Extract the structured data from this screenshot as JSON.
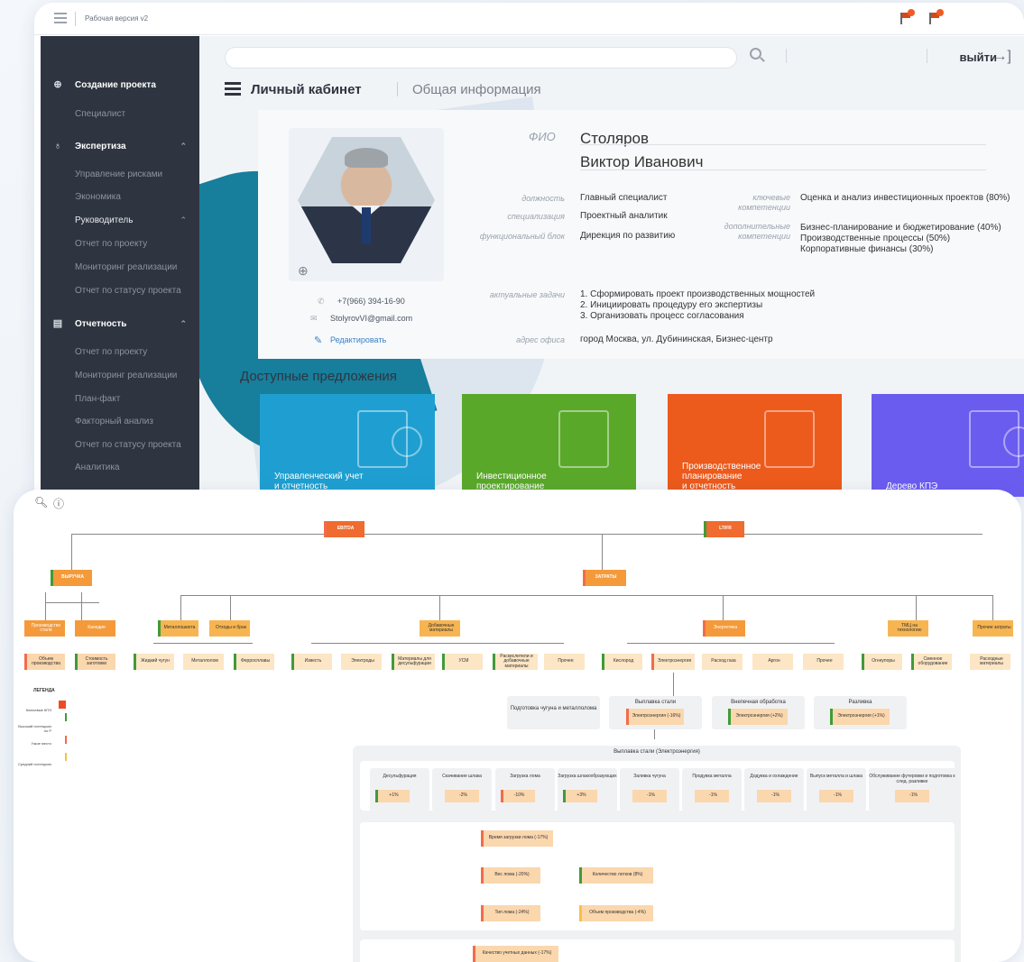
{
  "window": {
    "title": "Рабочая версия v2"
  },
  "sidebar": {
    "items": [
      {
        "label": "Создание проекта",
        "type": "head",
        "icon": "plus-circle-icon"
      },
      {
        "label": "Специалист",
        "type": "sub"
      },
      {
        "label": "Экспертиза",
        "type": "head",
        "icon": "medal-icon"
      },
      {
        "label": "Управление рисками",
        "type": "sub"
      },
      {
        "label": "Экономика",
        "type": "sub"
      },
      {
        "label": "Руководитель",
        "type": "group"
      },
      {
        "label": "Отчет по проекту",
        "type": "sub"
      },
      {
        "label": "Мониторинг реализации",
        "type": "sub"
      },
      {
        "label": "Отчет по статусу проекта",
        "type": "sub"
      },
      {
        "label": "Отчетность",
        "type": "head",
        "icon": "report-icon"
      },
      {
        "label": "Отчет по проекту",
        "type": "sub"
      },
      {
        "label": "Мониторинг реализации",
        "type": "sub"
      },
      {
        "label": "План-факт",
        "type": "sub"
      },
      {
        "label": "Факторный анализ",
        "type": "sub"
      },
      {
        "label": "Отчет по статусу проекта",
        "type": "sub"
      },
      {
        "label": "Аналитика",
        "type": "sub"
      }
    ]
  },
  "header": {
    "search_placeholder": "",
    "logout_label": "выйти",
    "breadcrumb_main": "Личный кабинет",
    "breadcrumb_sub": "Общая информация"
  },
  "profile": {
    "fio_label": "ФИО",
    "surname": "Столяров",
    "name": "Виктор Иванович",
    "phone": "+7(966) 394-16-90",
    "email": "StolyrovVI@gmail.com",
    "edit_label": "Редактировать",
    "position_label": "должность",
    "position": "Главный специалист",
    "specialization_label": "специализация",
    "specialization": "Проектный аналитик",
    "block_label": "функциональный блок",
    "block": "Дирекция по развитию",
    "key_comp_label": "ключевые компетенции",
    "key_comp": "Оценка и анализ инвестиционных проектов (80%)",
    "add_comp_label": "дополнительные компетенции",
    "add_comp_1": "Бизнес-планирование и бюджетирование (40%)",
    "add_comp_2": "Производственные процессы (50%)",
    "add_comp_3": "Корпоративные финансы (30%)",
    "tasks_label": "актуальные задачи",
    "task_1": "1. Сформировать проект производственных мощностей",
    "task_2": "2. Инициировать процедуру его экспертизы",
    "task_3": "3. Организовать процесс согласования",
    "office_label": "адрес офиса",
    "office": "город Москва, ул. Дубининская, Бизнес-центр"
  },
  "offers": {
    "title": "Доступные предложения",
    "tiles": [
      {
        "label": "Управленческий учет\nи отчетность",
        "color": "#1f9fd1"
      },
      {
        "label": "Инвестиционное\nпроектирование",
        "color": "#5aa82a"
      },
      {
        "label": "Производственное\nпланирование\nи отчетность",
        "color": "#ec5a1c"
      },
      {
        "label": "Дерево КПЭ",
        "color": "#6b5cf0"
      }
    ]
  },
  "tree": {
    "ebitda": "EBITDA",
    "ltifr": "LTIFR",
    "revenue": "ВЫРУЧКА",
    "costs": "ЗАТРАТЫ",
    "rev_children": [
      "Производство стали",
      "Канедия"
    ],
    "rev_leaves": [
      "Объем производства",
      "Стоимость заготовки"
    ],
    "cost_children": [
      "Металлошихта",
      "Отходы и брак",
      "Добавочные материалы",
      "Энергетика",
      "ТМЦ на технологию",
      "Прочие затраты"
    ],
    "metal_leaves": [
      "Жидкий чугун",
      "Металлолом",
      "Ферросплавы"
    ],
    "add_leaves": [
      "Известь",
      "Электроды",
      "Материалы для десульфурации",
      "УСМ",
      "Раскислители и добавочные материалы",
      "Прочее"
    ],
    "energy_leaves": [
      "Кислород",
      "Электроэнергия",
      "Расход газа",
      "Аргон",
      "Прочее"
    ],
    "tmc_leaves": [
      "Огнеупоры",
      "Сменное оборудование"
    ],
    "other_leaves": [
      "Расходные материалы"
    ],
    "legend_title": "ЛЕГЕНДА",
    "legend_items": [
      "Ключевые КПЭ",
      "Высокий потенциал по Р",
      "Узкое место",
      "Средний потенциал"
    ],
    "stages": [
      {
        "title": "Подготовка чугуна и металлолома",
        "item": ""
      },
      {
        "title": "Выплавка стали",
        "item": "Электроэнергия (-16%)"
      },
      {
        "title": "Внепечная обработка",
        "item": "Электроэнергия (+2%)"
      },
      {
        "title": "Разливка",
        "item": "Электроэнергия (+1%)"
      }
    ],
    "detail_title": "Выплавка стали (Электроэнергия)",
    "operations": [
      {
        "title": "Десульфурация",
        "value": "+1%"
      },
      {
        "title": "Скачивание шлака",
        "value": "-2%"
      },
      {
        "title": "Загрузка лома",
        "value": "-10%"
      },
      {
        "title": "Загрузка шлакообразующих",
        "value": "+3%"
      },
      {
        "title": "Заливка чугуна",
        "value": "-1%"
      },
      {
        "title": "Продувка металла",
        "value": "-1%"
      },
      {
        "title": "Додувка и охлаждение",
        "value": "-1%"
      },
      {
        "title": "Выпуск металла и шлака",
        "value": "-1%"
      },
      {
        "title": "Обслуживание футеровки и подготовка к след. разливке",
        "value": "-1%"
      }
    ],
    "factors": {
      "load_time": "Время загрузки лома (-17%)",
      "scrap_weight": "Вес лома (-20%)",
      "trays": "Количество лотков (8%)",
      "scrap_type": "Тип лома (-24%)",
      "volume": "Объем производства (-4%)",
      "data_quality": "Качество учетных данных (-17%)"
    }
  }
}
